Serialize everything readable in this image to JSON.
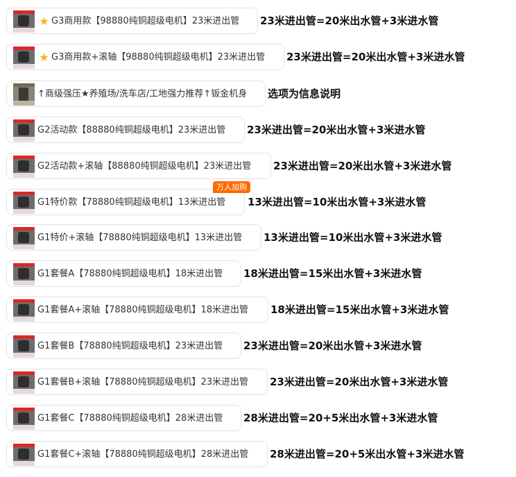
{
  "options": [
    {
      "label": "G3商用款【98880纯铜超级电机】23米进出管",
      "info": "23米进出管=20米出水管+3米进水管",
      "star": true
    },
    {
      "label": "G3商用款+滚轴【98880纯铜超级电机】23米进出管",
      "info": "23米进出管=20米出水管+3米进水管",
      "star": true
    },
    {
      "label": "↑商级强压★养殖场/洗车店/工地强力推荐↑钣金机身",
      "info": "选项为信息说明",
      "star": false
    },
    {
      "label": "G2活动款【88880纯铜超级电机】23米进出管",
      "info": "23米进出管=20米出水管+3米进水管",
      "star": false
    },
    {
      "label": "G2活动款+滚轴【88880纯铜超级电机】23米进出管",
      "info": "23米进出管=20米出水管+3米进水管",
      "star": false
    },
    {
      "label": "G1特价款【78880纯铜超级电机】13米进出管",
      "info": "13米进出管=10米出水管+3米进水管",
      "star": false,
      "badge": "万人加购"
    },
    {
      "label": "G1特价+滚轴【78880纯铜超级电机】13米进出管",
      "info": "13米进出管=10米出水管+3米进水管",
      "star": false
    },
    {
      "label": "G1套餐A【78880纯铜超级电机】18米进出管",
      "info": "18米进出管=15米出水管+3米进水管",
      "star": false
    },
    {
      "label": "G1套餐A+滚轴【78880纯铜超级电机】18米进出管",
      "info": "18米进出管=15米出水管+3米进水管",
      "star": false
    },
    {
      "label": "G1套餐B【78880纯铜超级电机】23米进出管",
      "info": "23米进出管=20米出水管+3米进水管",
      "star": false
    },
    {
      "label": "G1套餐B+滚轴【78880纯铜超级电机】23米进出管",
      "info": "23米进出管=20米出水管+3米进水管",
      "star": false
    },
    {
      "label": "G1套餐C【78880纯铜超级电机】28米进出管",
      "info": "28米进出管=20+5米出水管+3米进水管",
      "star": false
    },
    {
      "label": "G1套餐C+滚轴【78880纯铜超级电机】28米进出管",
      "info": "28米进出管=20+5米出水管+3米进水管",
      "star": false
    }
  ],
  "colors": {
    "star": "#f2b31c",
    "badge": "#ff6a00",
    "chip_border": "#e3e3e3"
  }
}
